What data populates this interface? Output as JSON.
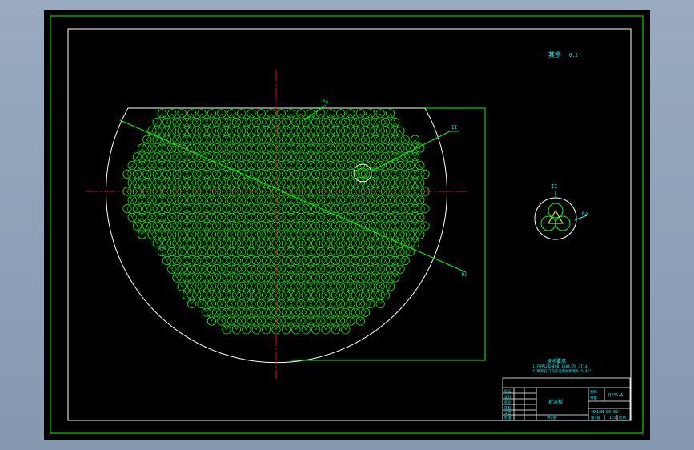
{
  "drawing": {
    "rough_note": "其余",
    "rough_mark": "6.3",
    "section_mark": "II",
    "ref_marks": {
      "top": "Ra",
      "right_leader": "II",
      "bottom_leader": "Ra",
      "detail_right": "Ra"
    },
    "tech_req": {
      "title": "技术要求",
      "line1": "1.孔径公差按GB 1804-79 IT14",
      "line2": "2.所有孔口均去毛刺并倒角0.5×45°"
    }
  },
  "title_block": {
    "part_name": "折流板",
    "drawing_no": "HX12H-00-02",
    "material": "Q235-A",
    "scale": "1:5",
    "sheet_count": "共1张",
    "sheet_no": "第1张",
    "left_rows": [
      "标记",
      "设计",
      "校对",
      "审核",
      "工艺",
      "批准"
    ],
    "right_labels": [
      "图样",
      "重量",
      "比例"
    ]
  },
  "colors": {
    "sheet_bg": "#000000",
    "frame": "#00ff00",
    "outline": "#ffffff",
    "centerline": "#ff0000",
    "annotation": "#00ffff",
    "holes": "#00ff00"
  }
}
